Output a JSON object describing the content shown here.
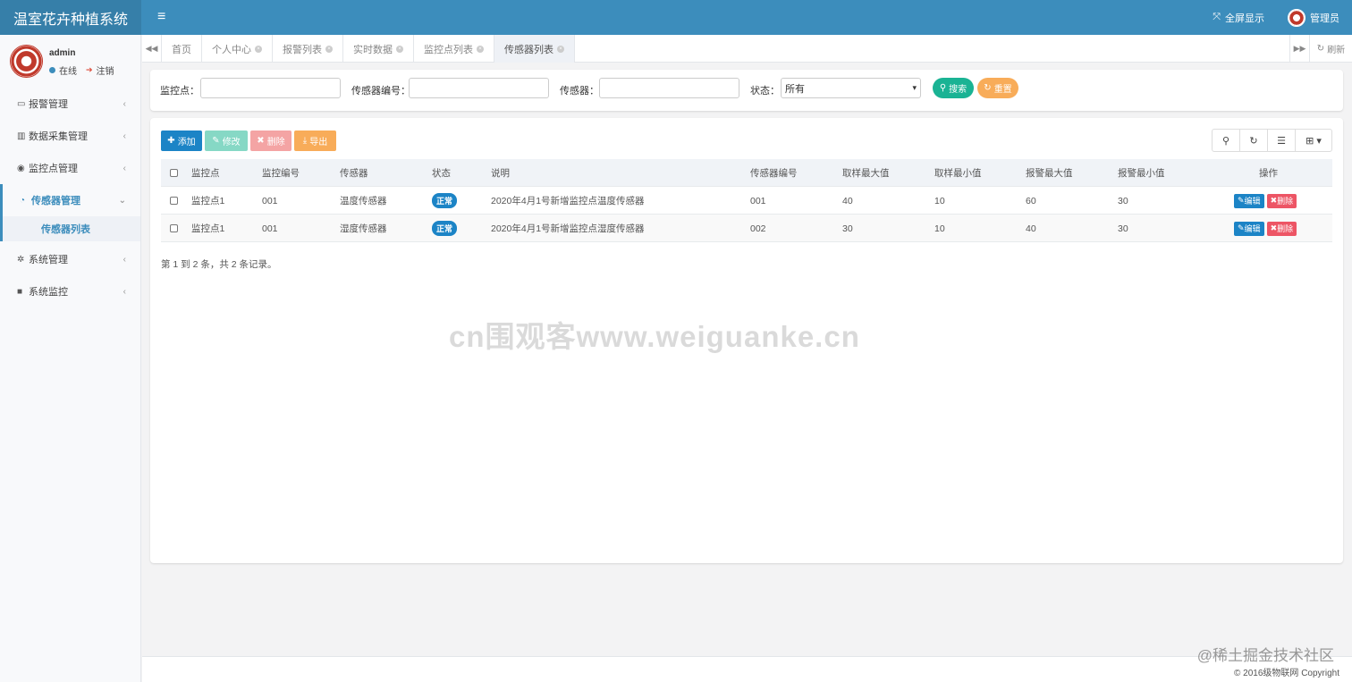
{
  "header": {
    "brand": "温室花卉种植系统",
    "hamburger_icon": "≡",
    "fullscreen_label": "全屏显示",
    "admin_label": "管理员"
  },
  "sidebar": {
    "user_name": "admin",
    "status_online": "在线",
    "logout": "注销",
    "items": [
      {
        "label": "报警管理",
        "icon": "monitor-icon"
      },
      {
        "label": "数据采集管理",
        "icon": "bar-chart-icon"
      },
      {
        "label": "监控点管理",
        "icon": "eye-icon"
      },
      {
        "label": "传感器管理",
        "icon": "dashboard-icon"
      },
      {
        "label": "系统管理",
        "icon": "gear-icon"
      },
      {
        "label": "系统监控",
        "icon": "video-camera-icon"
      }
    ],
    "sub_item": "传感器列表"
  },
  "tabs": {
    "items": [
      "首页",
      "个人中心",
      "报警列表",
      "实时数据",
      "监控点列表",
      "传感器列表"
    ],
    "refresh": "刷新"
  },
  "search": {
    "point_label": "监控点：",
    "sensor_no_label": "传感器编号：",
    "sensor_label": "传感器：",
    "status_label": "状态：",
    "status_value": "所有",
    "search_btn": "搜索",
    "reset_btn": "重置"
  },
  "toolbar": {
    "add": "添加",
    "edit": "修改",
    "delete": "删除",
    "export": "导出"
  },
  "table": {
    "columns": [
      "监控点",
      "监控编号",
      "传感器",
      "状态",
      "说明",
      "传感器编号",
      "取样最大值",
      "取样最小值",
      "报警最大值",
      "报警最小值",
      "操作"
    ],
    "rows": [
      {
        "point": "监控点1",
        "code": "001",
        "sensor": "温度传感器",
        "status": "正常",
        "desc": "2020年4月1号新增监控点温度传感器",
        "sensor_no": "001",
        "smax": "40",
        "smin": "10",
        "amax": "60",
        "amin": "30"
      },
      {
        "point": "监控点1",
        "code": "001",
        "sensor": "湿度传感器",
        "status": "正常",
        "desc": "2020年4月1号新增监控点湿度传感器",
        "sensor_no": "002",
        "smax": "30",
        "smin": "10",
        "amax": "40",
        "amin": "30"
      }
    ],
    "op_edit": "编辑",
    "op_delete": "删除",
    "pagination": "第 1 到 2 条，共 2 条记录。"
  },
  "watermark": "cn围观客www.weiguanke.cn",
  "footer": {
    "watermark": "@稀土掘金技术社区",
    "copyright": "© 2016级物联网 Copyright"
  },
  "colors": {
    "header": "#3c8dbc",
    "primary": "#1c84c6",
    "success": "#1ab394",
    "warning": "#f8ac59",
    "danger": "#ed5565"
  }
}
